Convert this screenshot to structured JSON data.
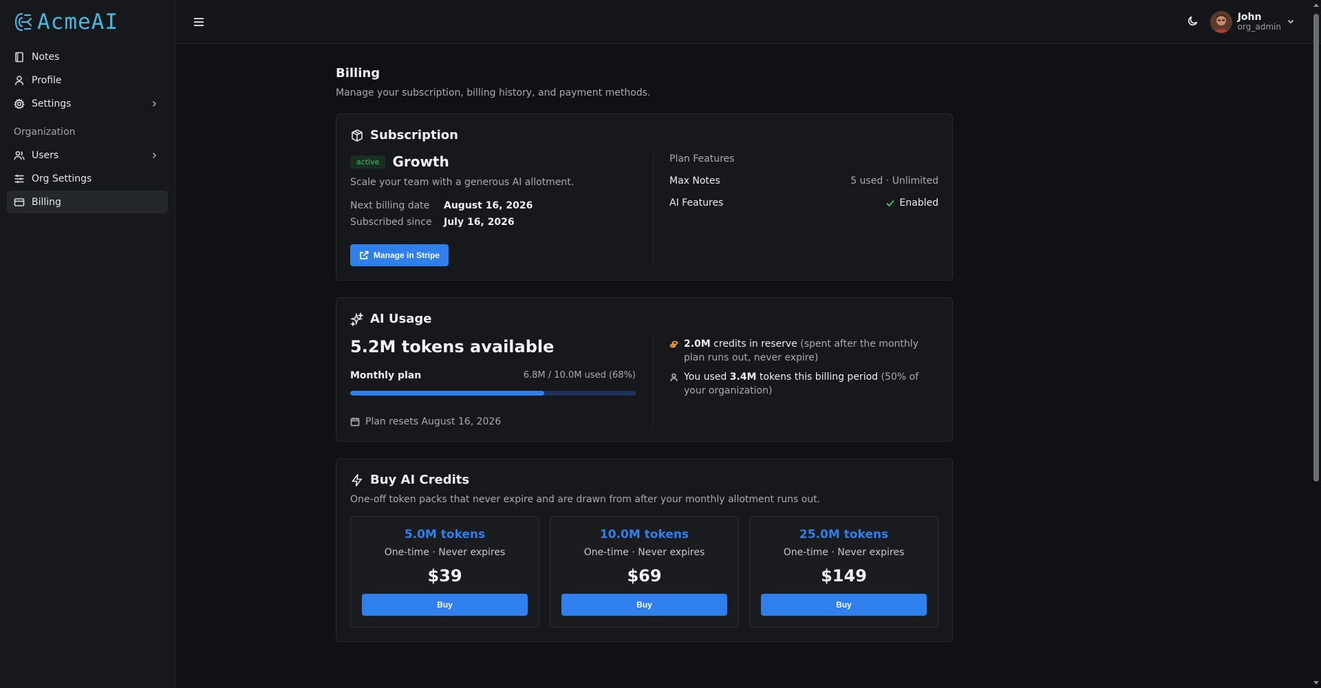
{
  "app": {
    "name": "AcmeAI"
  },
  "sidebar": {
    "items": [
      {
        "label": "Notes",
        "icon": "notebook-icon"
      },
      {
        "label": "Profile",
        "icon": "user-icon"
      },
      {
        "label": "Settings",
        "icon": "gear-icon"
      }
    ],
    "org_section": "Organization",
    "org_items": [
      {
        "label": "Users",
        "icon": "users-icon"
      },
      {
        "label": "Org Settings",
        "icon": "sliders-icon"
      },
      {
        "label": "Billing",
        "icon": "credit-card-icon"
      }
    ]
  },
  "user": {
    "name": "John",
    "role": "org_admin"
  },
  "page": {
    "title": "Billing",
    "subtitle": "Manage your subscription, billing history, and payment methods."
  },
  "subscription": {
    "title": "Subscription",
    "status": "active",
    "plan": "Growth",
    "description": "Scale your team with a generous AI allotment.",
    "next_billing_label": "Next billing date",
    "next_billing_value": "August 16, 2026",
    "since_label": "Subscribed since",
    "since_value": "July 16, 2026",
    "manage_label": "Manage in Stripe",
    "features_title": "Plan Features",
    "features": [
      {
        "name": "Max Notes",
        "value": "5 used · Unlimited"
      },
      {
        "name": "AI Features",
        "value": "Enabled"
      }
    ]
  },
  "ai_usage": {
    "title": "AI Usage",
    "available": "5.2M tokens available",
    "monthly_label": "Monthly plan",
    "monthly_value": "6.8M / 10.0M used (68%)",
    "progress_percent": 68,
    "reset_text": "Plan resets August 16, 2026",
    "reserve_strong": "2.0M",
    "reserve_mid": " credits in reserve",
    "reserve_rest": " (spent after the monthly plan runs out, never expire)",
    "used_a": "You used ",
    "used_b": "3.4M",
    "used_c": " tokens this billing period",
    "used_rest": " (50% of your organization)"
  },
  "credits": {
    "title": "Buy AI Credits",
    "subtitle": "One-off token packs that never expire and are drawn from after your monthly allotment runs out.",
    "packs": [
      {
        "tokens": "5.0M tokens",
        "meta": "One-time · Never expires",
        "price": "$39",
        "button": "Buy"
      },
      {
        "tokens": "10.0M tokens",
        "meta": "One-time · Never expires",
        "price": "$69",
        "button": "Buy"
      },
      {
        "tokens": "25.0M tokens",
        "meta": "One-time · Never expires",
        "price": "$149",
        "button": "Buy"
      }
    ]
  },
  "colors": {
    "accent": "#2f80ed",
    "logo": "#4ab7e0",
    "success": "#3fbf6a",
    "reserve": "#f0a030"
  }
}
